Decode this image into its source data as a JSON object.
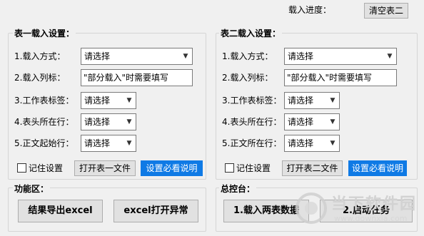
{
  "header": {
    "progress_label": "载入进度：",
    "clear_sheet2_button": "清空表二"
  },
  "sheet1": {
    "title": "表一载入设置：",
    "load_mode": {
      "label": "1.载入方式：",
      "value": "请选择"
    },
    "load_columns": {
      "label": "2.载入列标：",
      "value": "\"部分载入\"时需要填写"
    },
    "sheet_tab": {
      "label": "3.工作表标签：",
      "value": "请选择"
    },
    "header_row": {
      "label": "4.表头所在行：",
      "value": "请选择"
    },
    "body_start_row": {
      "label": "5.正文起始行：",
      "value": "请选择"
    },
    "remember_label": "记住设置",
    "open_file_button": "打开表一文件",
    "help_button": "设置必看说明"
  },
  "sheet2": {
    "title": "表二载入设置：",
    "load_mode": {
      "label": "1.载入方式：",
      "value": "请选择"
    },
    "load_columns": {
      "label": "2.载入列标：",
      "value": "\"部分载入\"时需要填写"
    },
    "sheet_tab": {
      "label": "3.工作表标签：",
      "value": "请选择"
    },
    "header_row": {
      "label": "4.表头所在行：",
      "value": "请选择"
    },
    "body_start_row": {
      "label": "5.正文所在行：",
      "value": "请选择"
    },
    "remember_label": "记住设置",
    "open_file_button": "打开表二文件",
    "help_button": "设置必看说明"
  },
  "functions": {
    "title": "功能区：",
    "export_button": "结果导出excel",
    "open_error_button": "excel打开异常"
  },
  "console": {
    "title": "总控台：",
    "load_both_button": "1.载入两表数据",
    "start_task_button": "2.启动任务"
  },
  "watermark": {
    "text": "当下软件园",
    "url": "www.downxia.com",
    "accent_color": "#e8e8e8"
  }
}
